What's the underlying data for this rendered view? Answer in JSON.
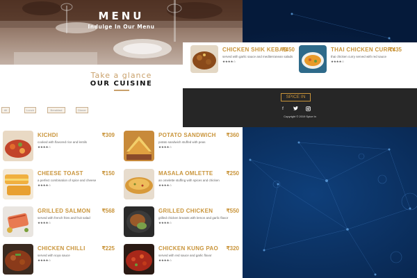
{
  "hero": {
    "title": "MENU",
    "subtitle": "Indulge In Our Menu"
  },
  "section": {
    "kicker": "Take a glance",
    "title": "OUR CUISINE"
  },
  "filters": [
    "All",
    "Lunch",
    "Breakfast",
    "Dinner"
  ],
  "menu_items": [
    {
      "name": "KICHDI",
      "price": "₹309",
      "desc": "cooked with flavored rice and lentils",
      "stars": "★★★★☆",
      "thumb": "kichdi"
    },
    {
      "name": "POTATO SANDWICH",
      "price": "₹360",
      "desc": "potato sandwich stuffed with peas",
      "stars": "★★★★☆",
      "thumb": "sandwich"
    },
    {
      "name": "CHEESE TOAST",
      "price": "₹150",
      "desc": "a perfect combination of spice and cheese",
      "stars": "★★★★☆",
      "thumb": "toast"
    },
    {
      "name": "MASALA OMLETTE",
      "price": "₹250",
      "desc": "an omelette stuffing with spices and chicken",
      "stars": "★★★★☆",
      "thumb": "omlette"
    },
    {
      "name": "GRILLED SALMON",
      "price": "₹568",
      "desc": "served with french fries and fruit salad",
      "stars": "★★★★☆",
      "thumb": "salmon"
    },
    {
      "name": "GRILLED CHICKEN",
      "price": "₹550",
      "desc": "grilled chicken breasts with lemon and garlic flavor",
      "stars": "★★★★☆",
      "thumb": "grilled"
    },
    {
      "name": "CHICKEN CHILLI",
      "price": "₹225",
      "desc": "served with soya sauce",
      "stars": "★★★★☆",
      "thumb": "chilli"
    },
    {
      "name": "CHICKEN KUNG PAO",
      "price": "₹320",
      "desc": "served with red sauce and garlic flavor",
      "stars": "★★★★☆",
      "thumb": "kungpao"
    }
  ],
  "right_items": [
    {
      "name": "CHICKEN SHIK KEBAB",
      "price": "₹450",
      "desc": "served with garlic sauce and mediterranean salads",
      "stars": "★★★★☆",
      "thumb": "kebab"
    },
    {
      "name": "THAI CHICKEN CURRY",
      "price": "₹435",
      "desc": "thai chicken curry served with red sauce",
      "stars": "★★★★☆",
      "thumb": "curry"
    }
  ],
  "footer": {
    "brand_button": "SPICE IN",
    "social_icons": [
      "facebook-icon",
      "twitter-icon",
      "instagram-icon"
    ],
    "copyright": "Copyright © 2019 Spice In"
  },
  "colors": {
    "accent": "#c9943a",
    "footer_bg": "#262626",
    "background": "#08224a"
  }
}
